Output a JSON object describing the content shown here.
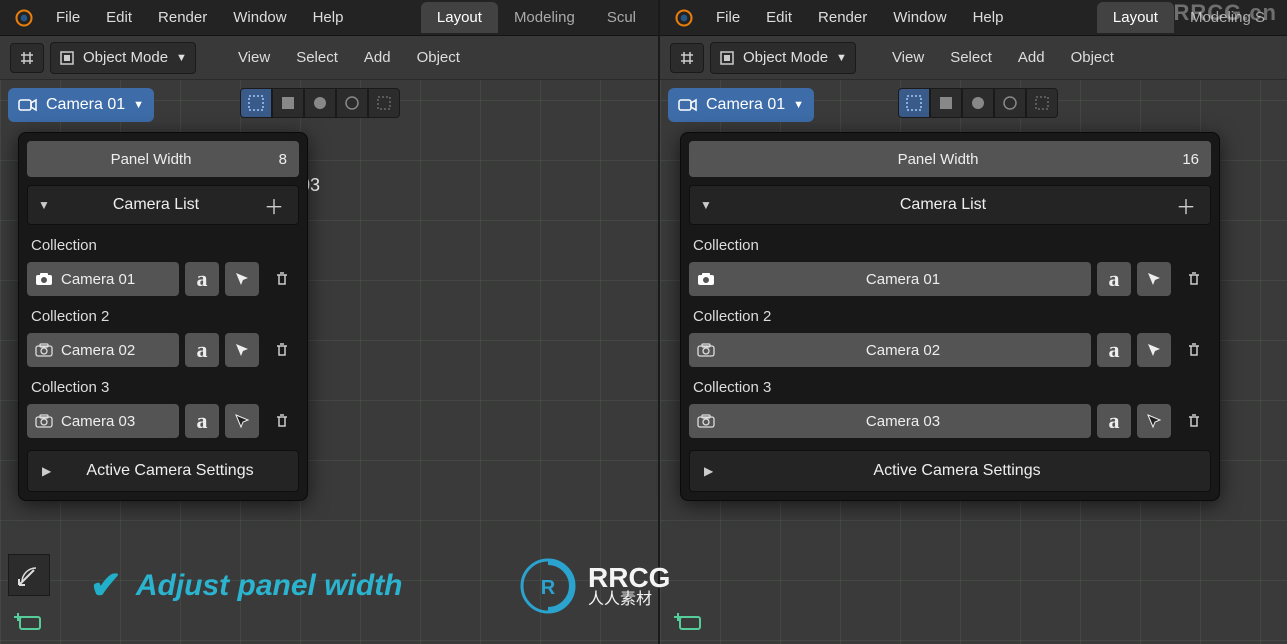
{
  "menu": {
    "file": "File",
    "edit": "Edit",
    "render": "Render",
    "window": "Window",
    "help": "Help"
  },
  "tabs": {
    "layout": "Layout",
    "modeling": "Modeling",
    "sculpt": "Scul"
  },
  "tabs_r": {
    "layout": "Layout",
    "modeling": "Modeling S"
  },
  "header": {
    "mode": "Object Mode",
    "view": "View",
    "select": "Select",
    "add": "Add",
    "object": "Object"
  },
  "camera_dd": "Camera 01",
  "viewport_obj": "03",
  "panel": {
    "width_label": "Panel Width",
    "left_value": "8",
    "right_value": "16",
    "camera_list_title": "Camera List",
    "collections": [
      {
        "label": "Collection",
        "camera": "Camera 01",
        "active": true
      },
      {
        "label": "Collection 2",
        "camera": "Camera 02",
        "active": false
      },
      {
        "label": "Collection 3",
        "camera": "Camera 03",
        "active": false
      }
    ],
    "active_settings": "Active Camera Settings"
  },
  "banner": {
    "text": "Adjust panel width"
  },
  "watermark": {
    "brand": "RRCG",
    "sub": "人人素材"
  },
  "watermark2": "RRCG.cn"
}
